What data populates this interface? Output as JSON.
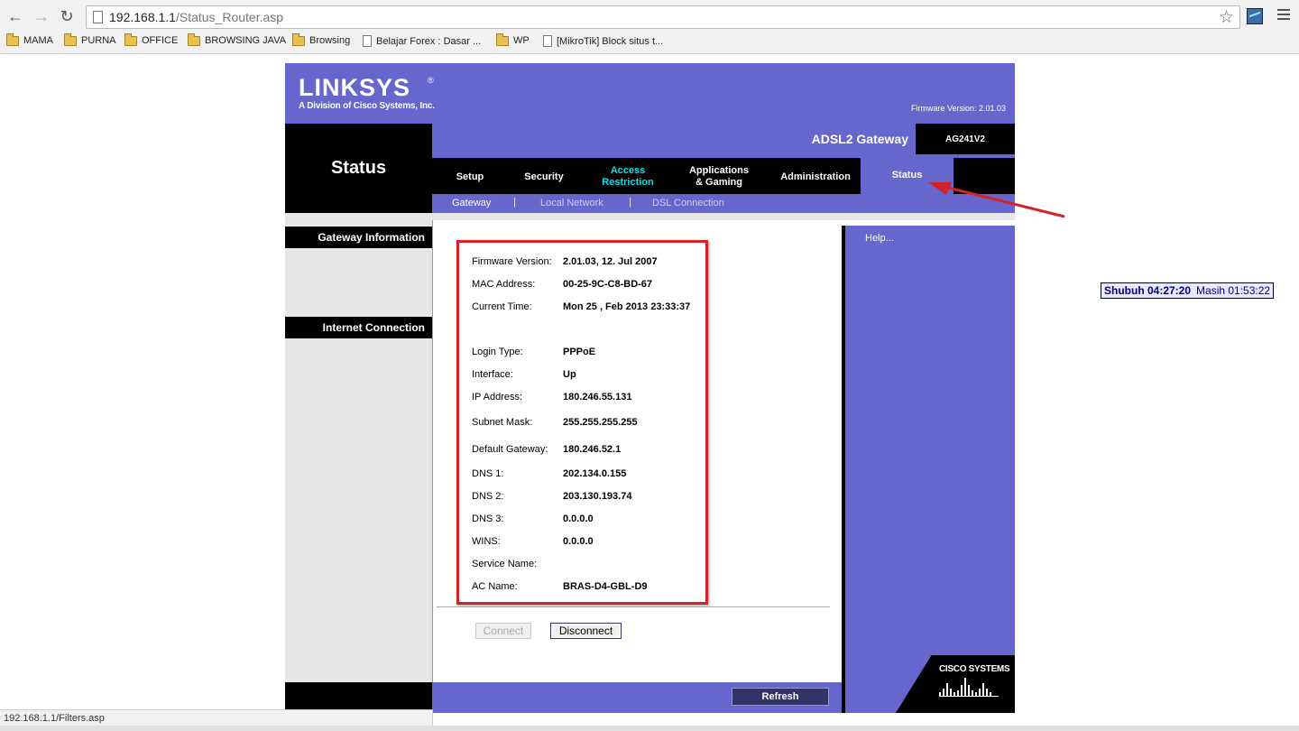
{
  "browser": {
    "url_host": "192.168.1.1",
    "url_path": "/Status_Router.asp",
    "status_url": "192.168.1.1/Filters.asp",
    "bookmarks": [
      {
        "label": "MAMA",
        "type": "folder"
      },
      {
        "label": "PURNA",
        "type": "folder"
      },
      {
        "label": "OFFICE",
        "type": "folder"
      },
      {
        "label": "BROWSING JAVA",
        "type": "folder"
      },
      {
        "label": "Browsing",
        "type": "folder"
      },
      {
        "label": "Belajar Forex : Dasar ...",
        "type": "page"
      },
      {
        "label": "WP",
        "type": "folder"
      },
      {
        "label": "[MikroTik] Block situs t...",
        "type": "page"
      }
    ]
  },
  "header": {
    "logo": "LINKSYS",
    "logo_reg": "®",
    "logo_sub": "A Division of Cisco Systems, Inc.",
    "firmware_version": "Firmware Version: 2.01.03",
    "section_title": "Status",
    "product_name": "ADSL2 Gateway",
    "model": "AG241V2"
  },
  "tabs": [
    {
      "label": "Setup"
    },
    {
      "label": "Security"
    },
    {
      "label": "Access\nRestriction"
    },
    {
      "label": "Applications\n& Gaming"
    },
    {
      "label": "Administration"
    },
    {
      "label": "Status"
    }
  ],
  "subtabs": [
    {
      "label": "Gateway"
    },
    {
      "label": "Local Network"
    },
    {
      "label": "DSL Connection"
    }
  ],
  "subtab_separator": "|",
  "sidebar": {
    "gateway_info": "Gateway Information",
    "internet_conn": "Internet Connection"
  },
  "info": [
    {
      "key": "Firmware Version:",
      "value": "2.01.03, 12. Jul 2007"
    },
    {
      "key": "MAC Address:",
      "value": "00-25-9C-C8-BD-67"
    },
    {
      "key": "Current Time:",
      "value": "Mon 25 , Feb 2013 23:33:37"
    },
    {
      "key": "Login Type:",
      "value": "PPPoE"
    },
    {
      "key": "Interface:",
      "value": "Up"
    },
    {
      "key": "IP Address:",
      "value": "180.246.55.131"
    },
    {
      "key": "Subnet Mask:",
      "value": "255.255.255.255"
    },
    {
      "key": "Default Gateway:",
      "value": "180.246.52.1"
    },
    {
      "key": "DNS 1:",
      "value": "202.134.0.155"
    },
    {
      "key": "DNS 2:",
      "value": "203.130.193.74"
    },
    {
      "key": "DNS 3:",
      "value": "0.0.0.0"
    },
    {
      "key": "WINS:",
      "value": "0.0.0.0"
    },
    {
      "key": "Service Name:",
      "value": ""
    },
    {
      "key": "AC Name:",
      "value": "BRAS-D4-GBL-D9"
    }
  ],
  "buttons": {
    "connect": "Connect",
    "disconnect": "Disconnect",
    "refresh": "Refresh"
  },
  "help_link": "Help...",
  "cisco_logo": "CISCO SYSTEMS",
  "prayer_clock": {
    "name_time": "Shubuh 04:27:20",
    "remaining": "Masih 01:53:22"
  },
  "colors": {
    "linksys_purple": "#6666cc",
    "highlight_cyan": "#00e5ee",
    "annotation_red": "#d2232a"
  }
}
